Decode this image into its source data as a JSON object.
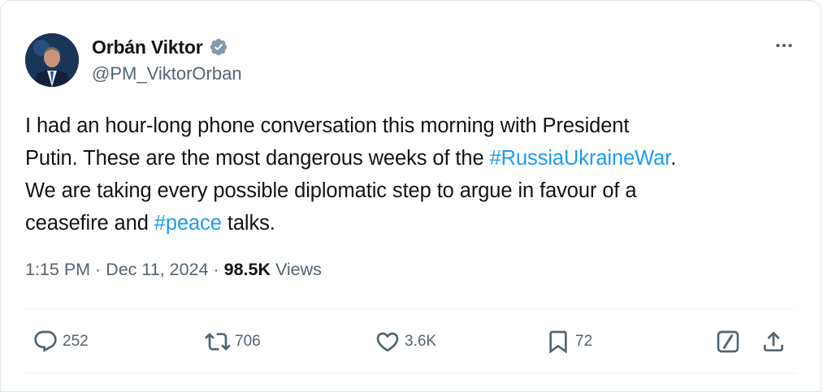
{
  "author": {
    "display_name": "Orbán Viktor",
    "handle": "@PM_ViktorOrban",
    "verified_icon": "verified-badge-icon",
    "accent_color": "#1d9bf0"
  },
  "tweet": {
    "lines": [
      [
        {
          "text": "I had an hour-long phone conversation this morning with President"
        }
      ],
      [
        {
          "text": "Putin. These are the most dangerous weeks of the "
        },
        {
          "text": "#RussiaUkraineWar",
          "hashtag": true
        },
        {
          "text": "."
        }
      ],
      [
        {
          "text": "We are taking every possible diplomatic step to argue in favour of a"
        }
      ],
      [
        {
          "text": "ceasefire and "
        },
        {
          "text": "#peace",
          "hashtag": true
        },
        {
          "text": " talks."
        }
      ]
    ]
  },
  "meta": {
    "time": "1:15 PM",
    "separator": " · ",
    "date": "Dec 11, 2024",
    "views_count": "98.5K",
    "views_label": " Views"
  },
  "actions": {
    "replies": "252",
    "reposts": "706",
    "likes": "3.6K",
    "bookmarks": "72"
  },
  "icons": {
    "more": "more-horizontal-icon",
    "reply": "reply-icon",
    "repost": "repost-icon",
    "like": "heart-icon",
    "bookmark": "bookmark-icon",
    "grok": "grok-icon",
    "share": "share-icon"
  }
}
